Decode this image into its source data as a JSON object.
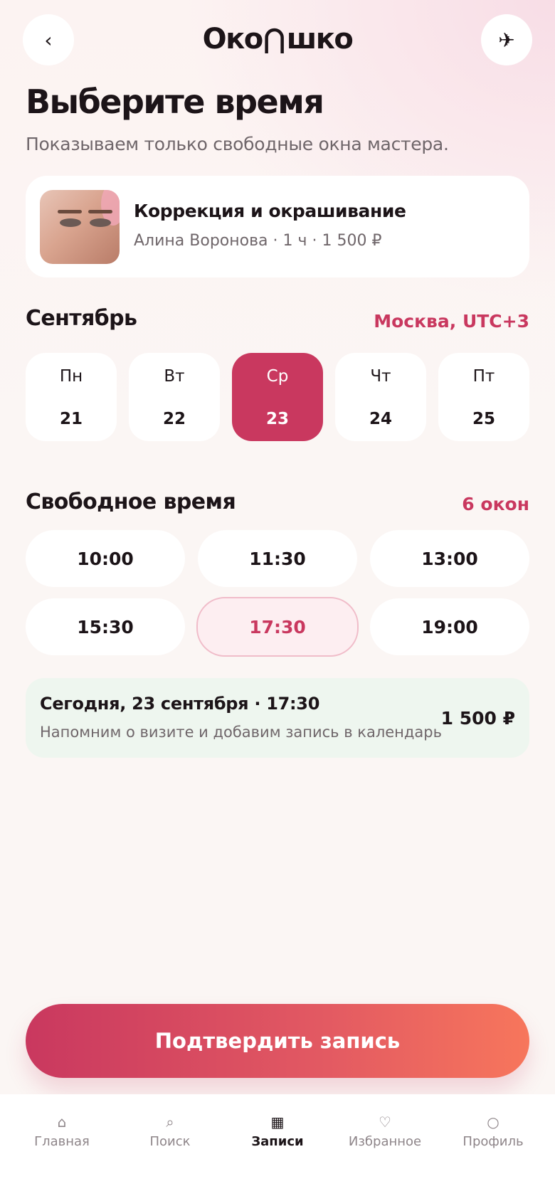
{
  "app": {
    "logo_left": "Око",
    "logo_right": "шко"
  },
  "header": {
    "back_icon": "‹",
    "send_icon": "✈"
  },
  "page": {
    "title": "Выберите время",
    "subtitle": "Показываем только свободные окна мастера."
  },
  "service": {
    "name": "Коррекция и окрашивание",
    "meta": "Алина Воронова · 1 ч · 1 500 ₽"
  },
  "calendar": {
    "month": "Сентябрь",
    "timezone": "Москва, UTC+3",
    "days": [
      {
        "name": "Пн",
        "num": "21",
        "selected": false
      },
      {
        "name": "Вт",
        "num": "22",
        "selected": false
      },
      {
        "name": "Ср",
        "num": "23",
        "selected": true
      },
      {
        "name": "Чт",
        "num": "24",
        "selected": false
      },
      {
        "name": "Пт",
        "num": "25",
        "selected": false
      }
    ]
  },
  "slots": {
    "title": "Свободное время",
    "count": "6 окон",
    "times": [
      "10:00",
      "11:30",
      "13:00",
      "15:30",
      "17:30",
      "19:00"
    ],
    "selected": "17:30"
  },
  "summary": {
    "title": "Сегодня, 23 сентября · 17:30",
    "subtitle": "Напомним о визите и добавим запись в календарь",
    "price": "1 500 ₽"
  },
  "cta": {
    "label": "Подтвердить запись"
  },
  "tabbar": {
    "items": [
      {
        "label": "Главная",
        "icon": "⌂",
        "icon_name": "home-icon",
        "active": false
      },
      {
        "label": "Поиск",
        "icon": "⌕",
        "icon_name": "search-icon",
        "active": false
      },
      {
        "label": "Записи",
        "icon": "▦",
        "icon_name": "calendar-icon",
        "active": true
      },
      {
        "label": "Избранное",
        "icon": "♡",
        "icon_name": "heart-icon",
        "active": false
      },
      {
        "label": "Профиль",
        "icon": "○",
        "icon_name": "profile-icon",
        "active": false
      }
    ]
  },
  "colors": {
    "accent": "#c9385f",
    "cta_gradient_end": "#f7765c",
    "summary_bg": "#eef6ef",
    "selected_slot_bg": "#fdeef1"
  }
}
